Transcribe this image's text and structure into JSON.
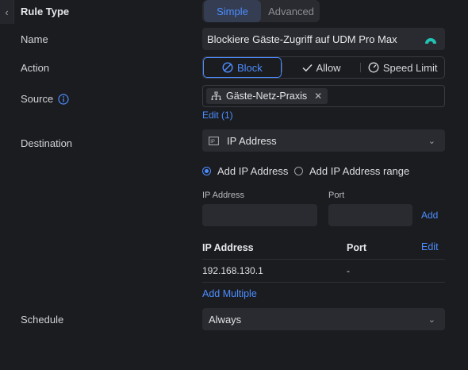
{
  "rule_type": {
    "label": "Rule Type",
    "options": [
      "Simple",
      "Advanced"
    ],
    "selected": "Simple"
  },
  "name": {
    "label": "Name",
    "value": "Blockiere Gäste-Zugriff auf UDM Pro Max"
  },
  "action": {
    "label": "Action",
    "options": [
      {
        "label": "Block",
        "icon": "block-icon"
      },
      {
        "label": "Allow",
        "icon": "check-icon"
      },
      {
        "label": "Speed Limit",
        "icon": "speedometer-icon"
      }
    ],
    "selected": "Block"
  },
  "source": {
    "label": "Source",
    "chip": "Gäste-Netz-Praxis",
    "edit_link": "Edit (1)"
  },
  "destination": {
    "label": "Destination",
    "type": "IP Address",
    "radio_add_ip": "Add IP Address",
    "radio_add_range": "Add IP Address range",
    "selected_radio": "Add IP Address",
    "ip_field_label": "IP Address",
    "port_field_label": "Port",
    "add_button": "Add",
    "table_headers": {
      "ip": "IP Address",
      "port": "Port",
      "edit": "Edit"
    },
    "rows": [
      {
        "ip": "192.168.130.1",
        "port": "-"
      }
    ],
    "add_multiple": "Add Multiple"
  },
  "schedule": {
    "label": "Schedule",
    "value": "Always"
  },
  "colors": {
    "accent": "#4c8dff",
    "background": "#1b1c20",
    "panel": "#2a2b30"
  }
}
